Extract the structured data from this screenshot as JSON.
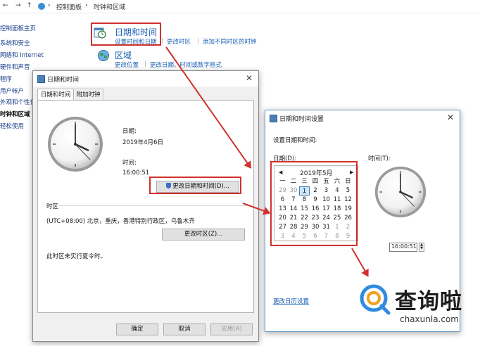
{
  "explorer": {
    "breadcrumb": [
      "控制面板",
      "时钟和区域"
    ]
  },
  "sidebar": {
    "items": [
      "控制面板主页",
      "系统和安全",
      "网络和 Internet",
      "硬件和声音",
      "程序",
      "用户帐户",
      "外观和个性化",
      "时钟和区域",
      "轻松使用"
    ]
  },
  "categories": {
    "datetime": {
      "title": "日期和时间",
      "links": [
        "设置时间和日期",
        "更改时区",
        "添加不同时区的时钟"
      ]
    },
    "region": {
      "title": "区域",
      "links": [
        "更改位置",
        "更改日期、时间或数字格式"
      ]
    }
  },
  "dt_dialog": {
    "title": "日期和时间",
    "tabs": [
      "日期和时间",
      "附加时钟"
    ],
    "date_label": "日期:",
    "date_value": "2019年4月6日",
    "time_label": "时间:",
    "time_value": "16:00:51",
    "change_dt_button": "更改日期和时间(D)...",
    "timezone_section": "时区",
    "timezone_value": "(UTC+08:00) 北京，重庆，香港特别行政区，乌鲁木齐",
    "change_tz_button": "更改时区(Z)...",
    "dst_note": "此时区未实行夏令时。",
    "ok": "确定",
    "cancel": "取消",
    "apply": "应用(A)"
  },
  "settings_dialog": {
    "title": "日期和时间设置",
    "heading": "设置日期和时间:",
    "date_label": "日期(D):",
    "time_label": "时间(T):",
    "calendar": {
      "month_title": "2019年5月",
      "prev": "◀",
      "next": "▶",
      "weekdays": [
        "一",
        "二",
        "三",
        "四",
        "五",
        "六",
        "日"
      ],
      "weeks": [
        [
          "29",
          "30",
          "1",
          "2",
          "3",
          "4",
          "5"
        ],
        [
          "6",
          "7",
          "8",
          "9",
          "10",
          "11",
          "12"
        ],
        [
          "13",
          "14",
          "15",
          "16",
          "17",
          "18",
          "19"
        ],
        [
          "20",
          "21",
          "22",
          "23",
          "24",
          "25",
          "26"
        ],
        [
          "27",
          "28",
          "29",
          "30",
          "31",
          "1",
          "2"
        ],
        [
          "3",
          "4",
          "5",
          "6",
          "7",
          "8",
          "9"
        ]
      ],
      "selected_day": "1"
    },
    "time_value": "16:00:51",
    "calendar_settings_link": "更改日历设置"
  },
  "watermark": {
    "name": "查询啦",
    "url": "chaxunla.com"
  },
  "colors": {
    "highlight_red": "#d0312d",
    "link_blue": "#1a5fb4"
  }
}
